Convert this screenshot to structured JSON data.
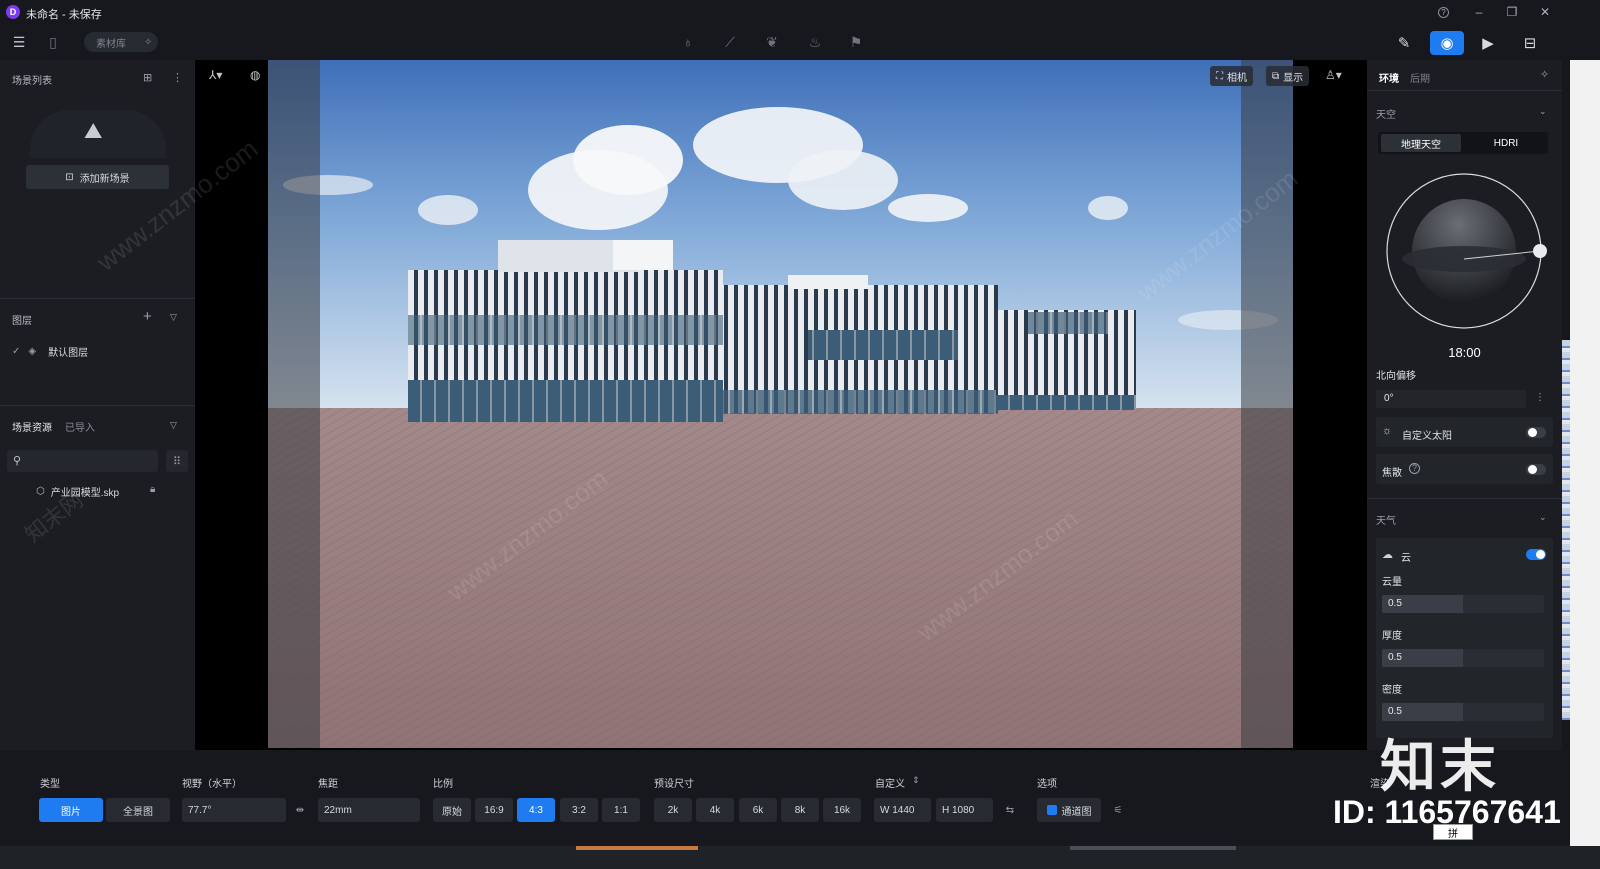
{
  "titlebar": {
    "logo": "D",
    "title": "未命名 - 未保存",
    "help": "?",
    "minimize": "–",
    "restore": "❐",
    "close": "✕"
  },
  "toolbar": {
    "asset_library": "素材库"
  },
  "left": {
    "scene_list_title": "场景列表",
    "add_scene_label": "添加新场景",
    "layers_title": "图层",
    "default_layer": "默认图层",
    "assets_tab_scene": "场景资源",
    "assets_tab_imported": "已导入",
    "asset_file": "产业园模型.skp"
  },
  "viewport": {
    "camera_label": "相机",
    "display_label": "显示"
  },
  "right": {
    "tab_env": "环境",
    "tab_post": "后期",
    "sky_title": "天空",
    "sky_mode_geo": "地理天空",
    "sky_mode_hdri": "HDRI",
    "time": "18:00",
    "north_offset_label": "北向偏移",
    "north_offset_value": "0°",
    "custom_sun_label": "自定义太阳",
    "custom_sun_on": false,
    "caustics_label": "焦散",
    "caustics_on": false,
    "weather_title": "天气",
    "cloud_label": "云",
    "cloud_on": true,
    "cloud_amount_label": "云量",
    "cloud_amount_value": "0.5",
    "thickness_label": "厚度",
    "thickness_value": "0.5",
    "density_label": "密度",
    "density_value": "0.5"
  },
  "bottom": {
    "type_label": "类型",
    "type_picture": "图片",
    "type_panorama": "全景图",
    "fov_label": "视野（水平）",
    "fov_value": "77.7°",
    "focal_label": "焦距",
    "focal_value": "22mm",
    "ratio_label": "比例",
    "ratios": [
      "原始",
      "16:9",
      "4:3",
      "3:2",
      "1:1"
    ],
    "ratio_active": "4:3",
    "preset_label": "预设尺寸",
    "presets": [
      "2k",
      "4k",
      "6k",
      "8k",
      "16k"
    ],
    "custom_label": "自定义",
    "width_value": "W 1440",
    "height_value": "H 1080",
    "options_label": "选项",
    "channel_label": "通道图",
    "render_label": "渲染"
  },
  "watermark": {
    "brand": "知末",
    "id_text": "ID: 1165767641",
    "site": "www.znzmo.com",
    "site_cn": "知末网"
  },
  "ime": {
    "label": "拼"
  },
  "colors": {
    "accent": "#1e7cf0",
    "bg": "#16181d",
    "panel": "#1b1d22"
  }
}
